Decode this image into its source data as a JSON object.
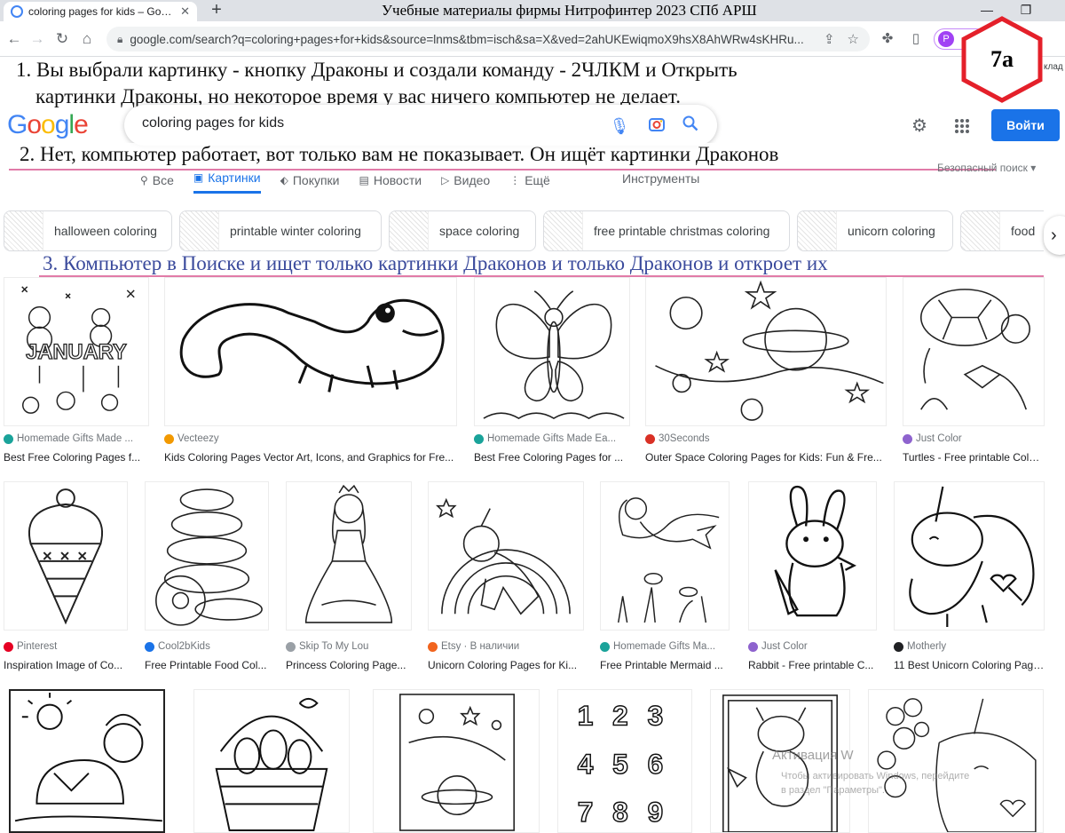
{
  "browser": {
    "tab_title": "coloring pages for kids – Google",
    "window_title": "Учебные материалы фирмы Нитрофинтер 2023 СПб АРШ",
    "url": "google.com/search?q=coloring+pages+for+kids&source=lnms&tbm=isch&sa=X&ved=2ahUKEwiqmoX9hsX8AhWRw4sKHRu...",
    "profile_initial": "P",
    "bookmark_cut": "клад"
  },
  "badge": {
    "label": "7а",
    "color": "#e4202a"
  },
  "annotations": {
    "a1_line1": "1. Вы выбрали картинку - кнопку Драконы и создали команду - 2ЧЛКМ и Открыть",
    "a1_line2": "картинки Драконы, но некоторое время у вас ничего компьютер не делает.",
    "a2": "2. Нет, компьютер работает, вот только вам не показывает. Он ищёт картинки Драконов",
    "a3": "3. Компьютер в Поиске и ищет только картинки Драконов и только Драконов и откроет их"
  },
  "google": {
    "logo_letters": [
      "G",
      "o",
      "o",
      "g",
      "l",
      "e"
    ],
    "query": "coloring pages for kids",
    "login_label": "Войти",
    "tabs": [
      {
        "label": "Все",
        "icon": "search-icon"
      },
      {
        "label": "Картинки",
        "icon": "image-icon"
      },
      {
        "label": "Покупки",
        "icon": "tag-icon"
      },
      {
        "label": "Новости",
        "icon": "news-icon"
      },
      {
        "label": "Видео",
        "icon": "play-icon"
      },
      {
        "label": "Ещё",
        "icon": "more-vertical-icon"
      }
    ],
    "tools_label": "Инструменты",
    "safesearch_label": "Безопасный поиск ▾"
  },
  "chips": [
    "halloween coloring",
    "printable winter coloring",
    "space coloring",
    "free printable christmas coloring",
    "unicorn coloring",
    "food"
  ],
  "results": [
    {
      "source": "Homemade Gifts Made ...",
      "caption": "Best Free Coloring Pages f...",
      "dot": "#1aa39a"
    },
    {
      "source": "Vecteezy",
      "caption": "Kids Coloring Pages Vector Art, Icons, and Graphics for Fre...",
      "dot": "#f29900"
    },
    {
      "source": "Homemade Gifts Made Ea...",
      "caption": "Best Free Coloring Pages for ...",
      "dot": "#1aa39a"
    },
    {
      "source": "30Seconds",
      "caption": "Outer Space Coloring Pages for Kids: Fun & Fre...",
      "dot": "#d93025"
    },
    {
      "source": "Just Color",
      "caption": "Turtles - Free printable Color...",
      "dot": "#8e63ce"
    },
    {
      "source": "Pinterest",
      "caption": "Inspiration Image of Co...",
      "dot": "#e60023"
    },
    {
      "source": "Cool2bKids",
      "caption": "Free Printable Food Col...",
      "dot": "#1a73e8"
    },
    {
      "source": "Skip To My Lou",
      "caption": "Princess Coloring Page...",
      "dot": "#9aa0a6"
    },
    {
      "source": "Etsy · В наличии",
      "caption": "Unicorn Coloring Pages for Ki...",
      "dot": "#f1641e"
    },
    {
      "source": "Homemade Gifts Ma...",
      "caption": "Free Printable Mermaid ...",
      "dot": "#1aa39a"
    },
    {
      "source": "Just Color",
      "caption": "Rabbit - Free printable C...",
      "dot": "#8e63ce"
    },
    {
      "source": "Motherly",
      "caption": "11 Best Unicorn Coloring Page...",
      "dot": "#202124"
    }
  ],
  "image_texts": {
    "january": "JANUARY"
  },
  "watermark": {
    "line1": "Активация W",
    "line2": "Чтобы активировать Windows, перейдите",
    "line3": "в раздел \"Параметры\"."
  }
}
